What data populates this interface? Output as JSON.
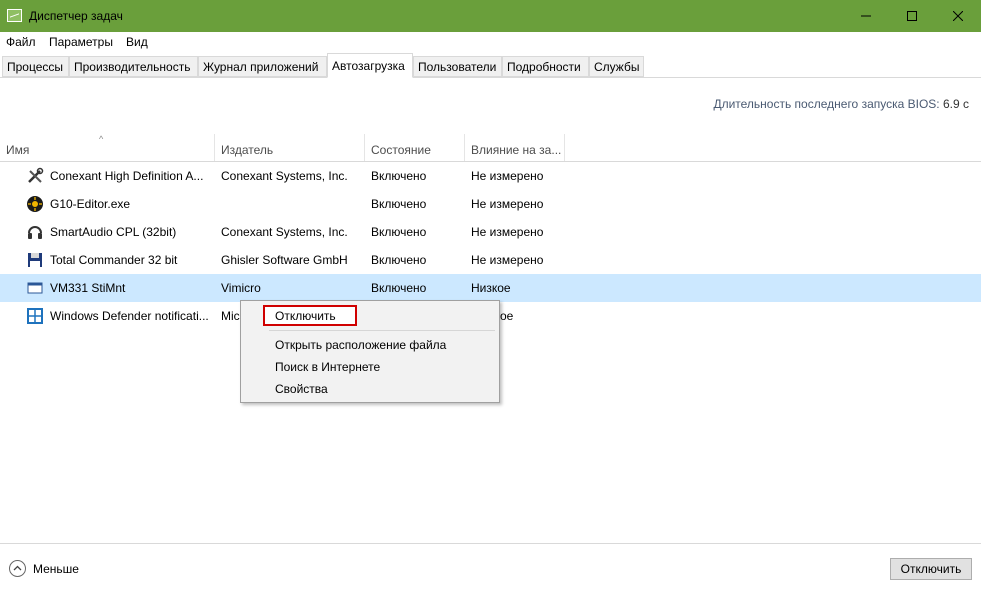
{
  "window": {
    "title": "Диспетчер задач"
  },
  "menu": {
    "items": [
      "Файл",
      "Параметры",
      "Вид"
    ]
  },
  "tabs": [
    {
      "label": "Процессы"
    },
    {
      "label": "Производительность"
    },
    {
      "label": "Журнал приложений"
    },
    {
      "label": "Автозагрузка",
      "active": true
    },
    {
      "label": "Пользователи"
    },
    {
      "label": "Подробности"
    },
    {
      "label": "Службы"
    }
  ],
  "bios": {
    "label": "Длительность последнего запуска BIOS:",
    "value": "6.9 с"
  },
  "columns": [
    "Имя",
    "Издатель",
    "Состояние",
    "Влияние на за..."
  ],
  "rows": [
    {
      "icon": "conexant-tools-icon",
      "name": "Conexant High Definition A...",
      "publisher": "Conexant Systems, Inc.",
      "status": "Включено",
      "impact": "Не измерено"
    },
    {
      "icon": "g10-editor-icon",
      "name": "G10-Editor.exe",
      "publisher": "",
      "status": "Включено",
      "impact": "Не измерено"
    },
    {
      "icon": "smartaudio-icon",
      "name": "SmartAudio CPL (32bit)",
      "publisher": "Conexant Systems, Inc.",
      "status": "Включено",
      "impact": "Не измерено"
    },
    {
      "icon": "floppy-disk-icon",
      "name": "Total Commander 32 bit",
      "publisher": "Ghisler Software GmbH",
      "status": "Включено",
      "impact": "Не измерено"
    },
    {
      "icon": "window-app-icon",
      "name": "VM331 StiMnt",
      "publisher": "Vimicro",
      "status": "Включено",
      "impact": "Низкое",
      "selected": true
    },
    {
      "icon": "defender-shield-icon",
      "name": "Windows Defender notificati...",
      "publisher": "Mic",
      "status": "",
      "impact": "oe"
    }
  ],
  "context_menu": {
    "items": [
      "Отключить",
      "Открыть расположение файла",
      "Поиск в Интернете",
      "Свойства"
    ]
  },
  "footer": {
    "less_label": "Меньше",
    "disable_button": "Отключить"
  },
  "colors": {
    "titlebar": "#6a9f3b",
    "selected_row": "#cce8ff",
    "highlight_border": "#d00000"
  }
}
